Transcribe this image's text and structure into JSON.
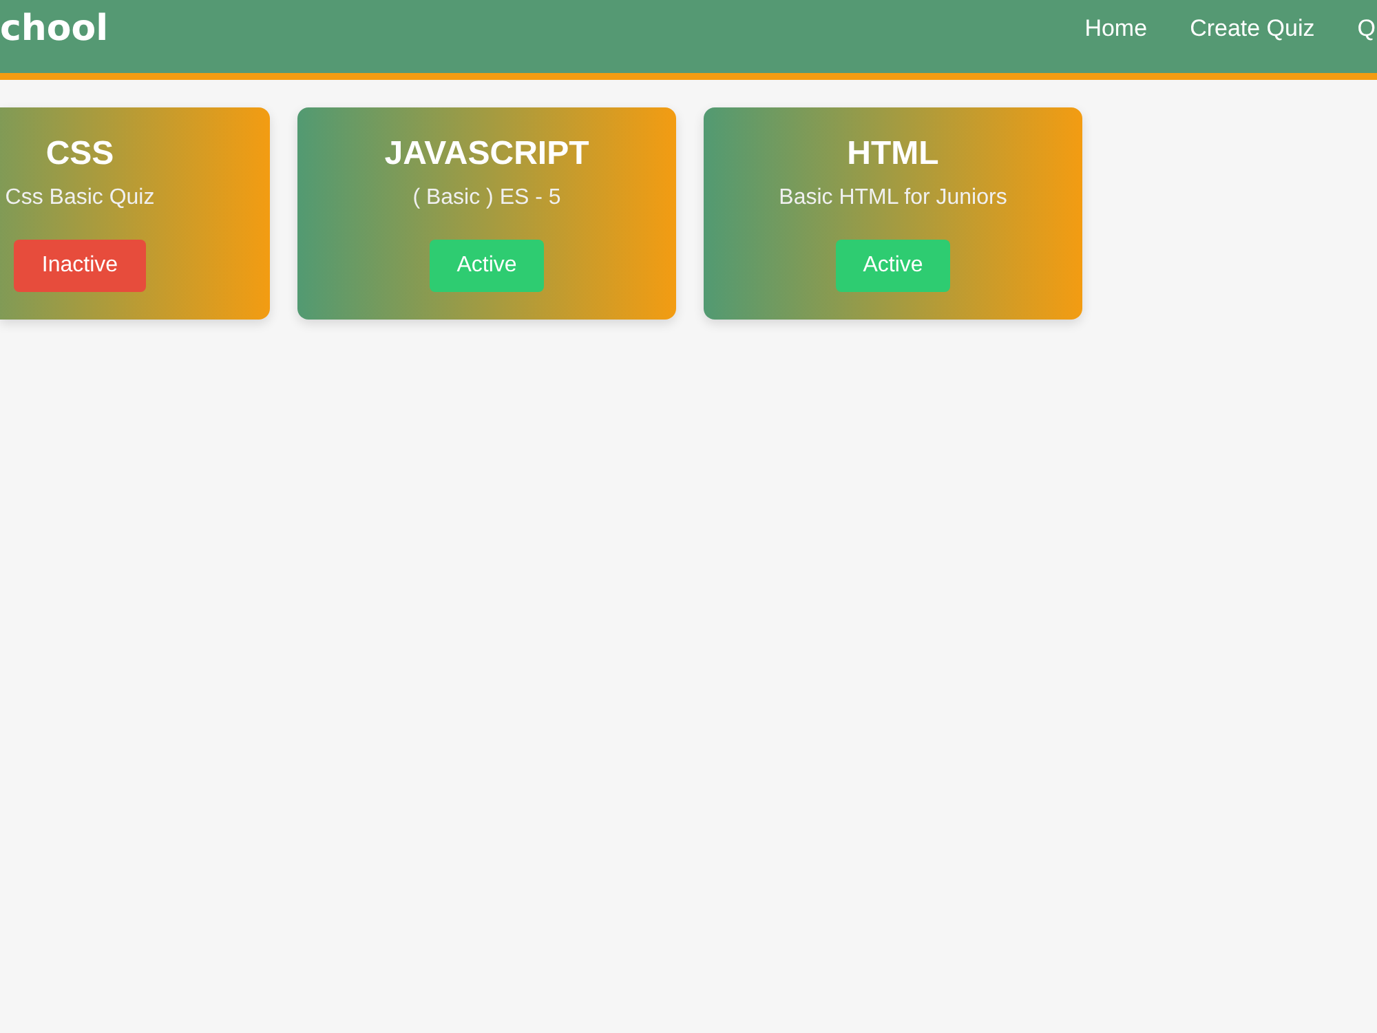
{
  "navbar": {
    "logo": "chool",
    "links": [
      "Home",
      "Create Quiz",
      "Q"
    ]
  },
  "quizzes": [
    {
      "title": "CSS",
      "description": "Css Basic Quiz",
      "status": "Inactive",
      "active": false
    },
    {
      "title": "JAVASCRIPT",
      "description": "( Basic ) ES - 5",
      "status": "Active",
      "active": true
    },
    {
      "title": "HTML",
      "description": "Basic HTML for Juniors",
      "status": "Active",
      "active": true
    }
  ]
}
